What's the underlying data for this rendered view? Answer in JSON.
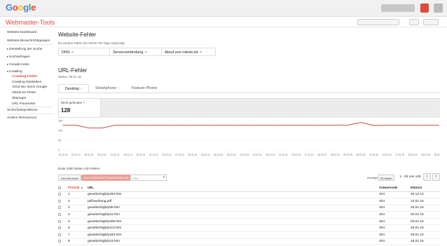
{
  "header": {
    "logo_letters": [
      "G",
      "o",
      "o",
      "g",
      "l",
      "e"
    ]
  },
  "brand": "Webmaster-Tools",
  "sidebar": {
    "items": [
      {
        "label": "Website-Dashboard",
        "kind": "top"
      },
      {
        "label": "Website-Benachrichtigungen",
        "kind": "top"
      },
      {
        "label": "Darstellung der Suche",
        "kind": "collapsed"
      },
      {
        "label": "Suchanfragen",
        "kind": "collapsed"
      },
      {
        "label": "Google-Index",
        "kind": "collapsed"
      },
      {
        "label": "Crawling",
        "kind": "expanded"
      },
      {
        "label": "Crawling-Fehler",
        "kind": "active"
      },
      {
        "label": "Crawling-Statistiken",
        "kind": "sub"
      },
      {
        "label": "Abruf wie durch Google",
        "kind": "sub"
      },
      {
        "label": "robots.txt-Tester",
        "kind": "sub"
      },
      {
        "label": "Sitemaps",
        "kind": "sub"
      },
      {
        "label": "URL-Parameter",
        "kind": "sub"
      },
      {
        "label": "Sicherheitsprobleme",
        "kind": "top"
      },
      {
        "label": "Andere Ressourcen",
        "kind": "top"
      }
    ]
  },
  "site_errors": {
    "title": "Website-Fehler",
    "subtitle": "Es werden Daten der letzten 90 Tage angezeigt",
    "cells": [
      {
        "label": "DNS",
        "status": "✔"
      },
      {
        "label": "Serververbindung",
        "status": "✔"
      },
      {
        "label": "Abruf von robots.txt",
        "status": "✔"
      }
    ]
  },
  "url_errors": {
    "title": "URL-Fehler",
    "status": "Status: 29.01.15",
    "tabs": [
      "Desktop",
      "Smartphone",
      "Feature-Phone"
    ],
    "active_tab": 0,
    "help_glyph": "?",
    "summary_label": "Nicht gefunden",
    "summary_value": "128"
  },
  "colors": {
    "accent": "#dd4b39",
    "ok": "#34a853",
    "line": "#c0392b"
  },
  "chart_data": {
    "type": "line",
    "title": "",
    "xlabel": "",
    "ylabel": "",
    "ylim": [
      0,
      150
    ],
    "yticks": [
      "150",
      "100",
      "50",
      "0"
    ],
    "x": [
      "31.10.14",
      "03.11.14",
      "06.11.14",
      "09.11.14",
      "12.11.14",
      "15.11.14",
      "18.11.14",
      "21.11.14",
      "24.11.14",
      "27.11.14",
      "30.11.14",
      "03.12.14",
      "06.12.14",
      "09.12.14",
      "12.12.14",
      "15.12.14",
      "18.12.14",
      "21.12.14",
      "24.12.14",
      "27.12.14",
      "30.12.14",
      "02.01.15",
      "05.01.15",
      "08.01.15",
      "11.01.15",
      "14.01.15",
      "17.01.15",
      "20.01.15",
      "23.01.15",
      "26.01.15"
    ],
    "series": [
      {
        "values": [
          126,
          126,
          112,
          112,
          126,
          126,
          126,
          126,
          126,
          126,
          126,
          126,
          126,
          126,
          126,
          126,
          126,
          126,
          126,
          126,
          126,
          126,
          127,
          140,
          125,
          126,
          126,
          126,
          126,
          126
        ]
      }
    ],
    "grid": true
  },
  "list": {
    "caption": "Erste 1000 Seiten mit Fehlern",
    "download_label": "Herunterladen",
    "fixed_label": "ALS KORRIGIERT MARKIEREN (0)",
    "filter_placeholder": "Filter",
    "show_label": "Anzeigen",
    "per_page": "25 Zeilen",
    "range": "1 - 25 von 128",
    "columns": {
      "priority": "Priorität ▲",
      "url": "URL",
      "code": "Antwortcode",
      "date": "Erkannt"
    },
    "rows": [
      {
        "priority": "1",
        "url": "gewebe/stgb/p284.htm",
        "code": "404",
        "date": "20.12.14"
      },
      {
        "priority": "2",
        "url": "pdf/aushang.pdf",
        "code": "404",
        "date": "12.01.15"
      },
      {
        "priority": "3",
        "url": "gewebe/stgb/p88.htm",
        "code": "404",
        "date": "25.01.15"
      },
      {
        "priority": "4",
        "url": "gewebe/stgb/p24.htm",
        "code": "404",
        "date": "02.01.15"
      },
      {
        "priority": "5",
        "url": "gewebe/stgb/p259.htm",
        "code": "404",
        "date": "03.01.15"
      },
      {
        "priority": "6",
        "url": "gewebe/stgb/p113.htm",
        "code": "404",
        "date": "26.01.15"
      },
      {
        "priority": "7",
        "url": "gewebe/stgb/p283.htm",
        "code": "404",
        "date": "26.01.15"
      },
      {
        "priority": "8",
        "url": "gewebe/stgb/p19.htm",
        "code": "404",
        "date": "26.01.15"
      }
    ]
  }
}
